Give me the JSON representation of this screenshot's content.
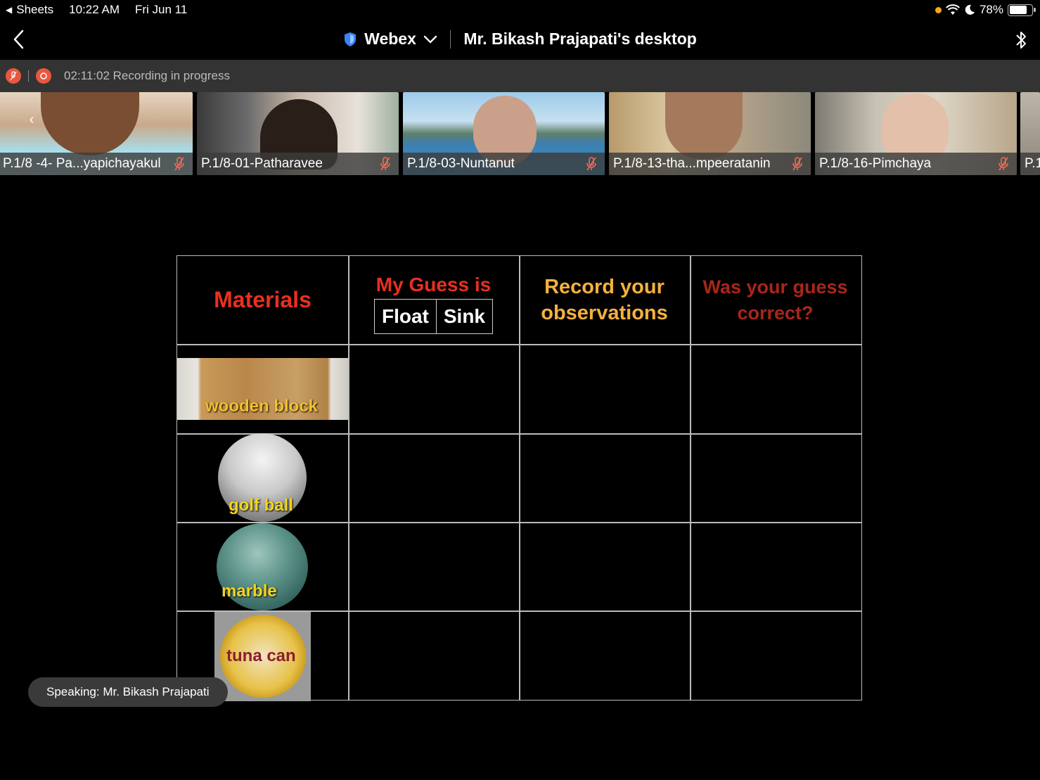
{
  "status_bar": {
    "back_app": "Sheets",
    "time": "10:22 AM",
    "date": "Fri Jun 11",
    "battery": "78%",
    "battery_level": 0.78
  },
  "header": {
    "app_name": "Webex",
    "title": "Mr. Bikash Prajapati's desktop"
  },
  "recording": {
    "text": "02:11:02 Recording in progress"
  },
  "participants": [
    {
      "name": "P.1/8 -4- Pa...yapichayakul"
    },
    {
      "name": "P.1/8-01-Patharavee"
    },
    {
      "name": "P.1/8-03-Nuntanut"
    },
    {
      "name": "P.1/8-13-tha...mpeeratanin"
    },
    {
      "name": "P.1/8-16-Pimchaya"
    },
    {
      "name": "P.1"
    }
  ],
  "worksheet": {
    "headers": {
      "materials": "Materials",
      "guess": "My Guess is",
      "float": "Float",
      "sink": "Sink",
      "record_line1": "Record your",
      "record_line2": "observations",
      "correct_line1": "Was your guess",
      "correct_line2": "correct?"
    },
    "materials": [
      "wooden block",
      "golf ball",
      "marble",
      "tuna can"
    ]
  },
  "speaking": {
    "text": "Speaking: Mr. Bikash Prajapati"
  },
  "colors": {
    "accent_red": "#e8301f",
    "accent_orange": "#f5b13d",
    "recording": "#e8583e"
  }
}
